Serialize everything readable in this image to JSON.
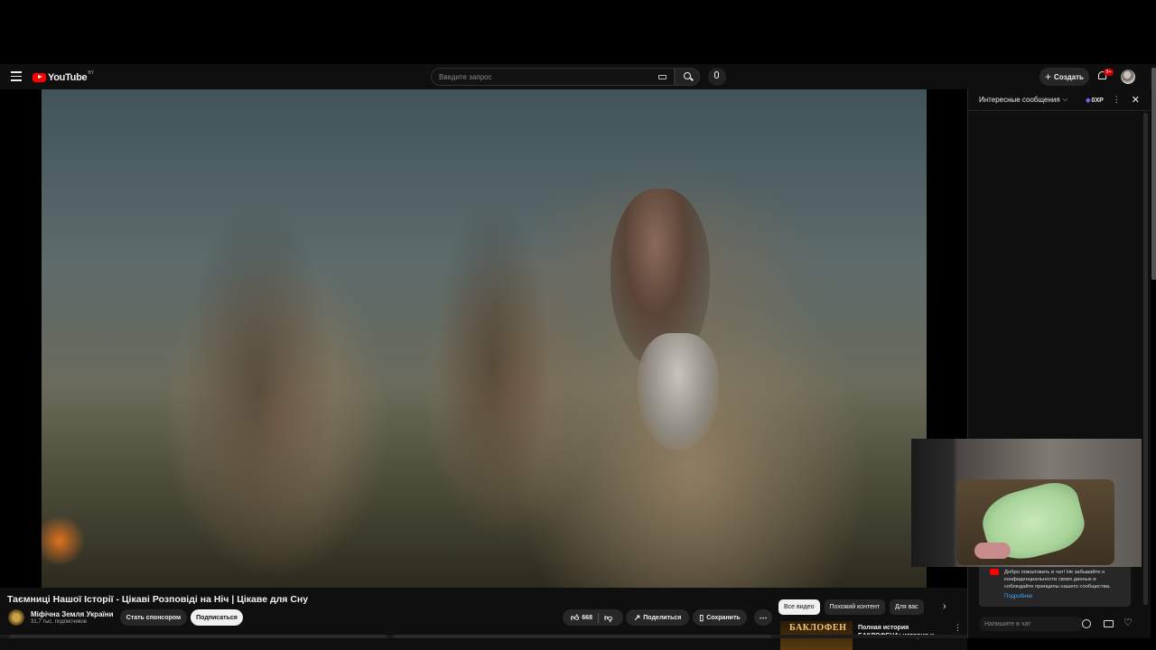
{
  "header": {
    "logo_text": "YouTube",
    "logo_country": "BY",
    "search_placeholder": "Введите запрос",
    "create_label": "Создать",
    "notifications_badge": "9+"
  },
  "chat": {
    "mode_label": "Интересные сообщения",
    "xp_label": "0XP",
    "welcome_text": "Добро пожаловать в чат! Не забывайте о конфиденциальности своих данных и соблюдайте принципы нашего сообщества.",
    "learn_more": "Подробнее",
    "input_placeholder": "Напишите в чат"
  },
  "video": {
    "title": "Таємниці Нашої Історії - Цікаві Розповіді на Ніч | Цікаве для Сну",
    "channel_name": "Міфічна Земля України",
    "subscribers": "31,7 тыс. подписчиков",
    "sponsor_label": "Стать спонсором",
    "subscribe_label": "Подписаться",
    "like_count": "668",
    "share_label": "Поделиться",
    "save_label": "Сохранить"
  },
  "recommendations": {
    "chips": [
      "Все видео",
      "Похожий контент",
      "Для вас"
    ],
    "first_title": "Полная история БАКЛОФЕНА: история и значение. От...",
    "first_thumb_text": "БАКЛОФЕН"
  },
  "colors": {
    "background": "#0f0f0f",
    "accent_red": "#ff0000",
    "link_blue": "#3ea6ff"
  }
}
